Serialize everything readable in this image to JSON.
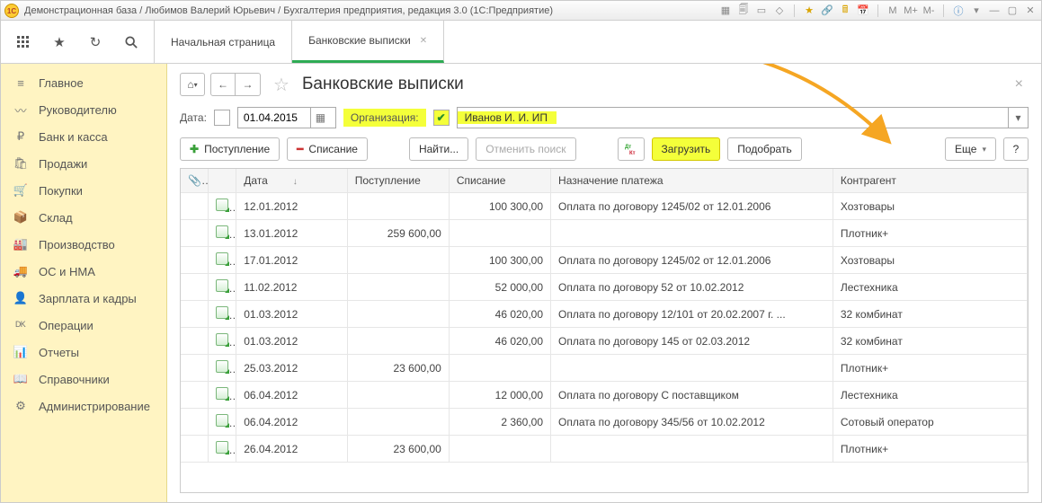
{
  "titlebar": {
    "title": "Демонстрационная база / Любимов Валерий Юрьевич / Бухгалтерия предприятия, редакция 3.0  (1С:Предприятие)"
  },
  "tabs": {
    "home": "Начальная страница",
    "active": "Банковские выписки"
  },
  "sidebar": {
    "items": [
      {
        "icon": "≡",
        "label": "Главное"
      },
      {
        "icon": "〰",
        "label": "Руководителю"
      },
      {
        "icon": "₽",
        "label": "Банк и касса"
      },
      {
        "icon": "🛍",
        "label": "Продажи"
      },
      {
        "icon": "🛒",
        "label": "Покупки"
      },
      {
        "icon": "📦",
        "label": "Склад"
      },
      {
        "icon": "🏭",
        "label": "Производство"
      },
      {
        "icon": "🚚",
        "label": "ОС и НМА"
      },
      {
        "icon": "👤",
        "label": "Зарплата и кадры"
      },
      {
        "icon": "ᴰᴷ",
        "label": "Операции"
      },
      {
        "icon": "📊",
        "label": "Отчеты"
      },
      {
        "icon": "📖",
        "label": "Справочники"
      },
      {
        "icon": "⚙",
        "label": "Администрирование"
      }
    ]
  },
  "page": {
    "title": "Банковские выписки"
  },
  "filter": {
    "date_label": "Дата:",
    "date_value": "01.04.2015",
    "org_label": "Организация:",
    "org_value": "Иванов И. И. ИП"
  },
  "toolbar": {
    "income": "Поступление",
    "expense": "Списание",
    "find": "Найти...",
    "cancel_find": "Отменить поиск",
    "load": "Загрузить",
    "pick": "Подобрать",
    "more": "Еще",
    "help": "?"
  },
  "table": {
    "headers": {
      "clip": "",
      "date": "Дата",
      "income": "Поступление",
      "expense": "Списание",
      "purpose": "Назначение платежа",
      "contragent": "Контрагент"
    },
    "rows": [
      {
        "date": "12.01.2012",
        "in": "",
        "out": "100 300,00",
        "purpose": "Оплата по договору 1245/02 от 12.01.2006",
        "ctr": "Хозтовары"
      },
      {
        "date": "13.01.2012",
        "in": "259 600,00",
        "out": "",
        "purpose": "",
        "ctr": "Плотник+"
      },
      {
        "date": "17.01.2012",
        "in": "",
        "out": "100 300,00",
        "purpose": "Оплата по договору 1245/02 от 12.01.2006",
        "ctr": "Хозтовары"
      },
      {
        "date": "11.02.2012",
        "in": "",
        "out": "52 000,00",
        "purpose": "Оплата по договору 52 от 10.02.2012",
        "ctr": "Лестехника"
      },
      {
        "date": "01.03.2012",
        "in": "",
        "out": "46 020,00",
        "purpose": "Оплата по договору 12/101 от 20.02.2007 г. ...",
        "ctr": "32 комбинат"
      },
      {
        "date": "01.03.2012",
        "in": "",
        "out": "46 020,00",
        "purpose": "Оплата по договору 145 от 02.03.2012",
        "ctr": "32 комбинат"
      },
      {
        "date": "25.03.2012",
        "in": "23 600,00",
        "out": "",
        "purpose": "",
        "ctr": "Плотник+"
      },
      {
        "date": "06.04.2012",
        "in": "",
        "out": "12 000,00",
        "purpose": "Оплата по договору С поставщиком",
        "ctr": "Лестехника"
      },
      {
        "date": "06.04.2012",
        "in": "",
        "out": "2 360,00",
        "purpose": "Оплата по договору 345/56 от 10.02.2012",
        "ctr": "Сотовый оператор"
      },
      {
        "date": "26.04.2012",
        "in": "23 600,00",
        "out": "",
        "purpose": "",
        "ctr": "Плотник+"
      }
    ]
  }
}
